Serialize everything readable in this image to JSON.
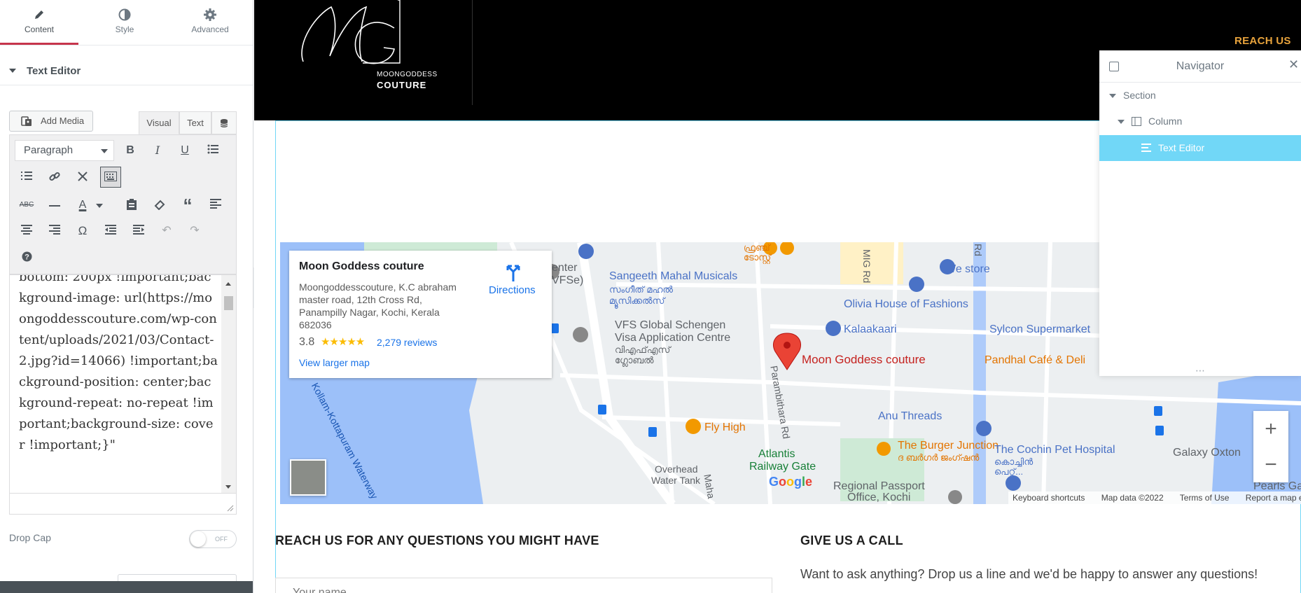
{
  "panel": {
    "tabs": [
      {
        "label": "Content",
        "icon": "pencil-icon"
      },
      {
        "label": "Style",
        "icon": "half-circle-icon"
      },
      {
        "label": "Advanced",
        "icon": "gear-icon"
      }
    ],
    "section_title": "Text Editor",
    "add_media": "Add Media",
    "editor_tabs": {
      "visual": "Visual",
      "text": "Text"
    },
    "format_select": "Paragraph",
    "editor_content": "bottom: 200px !important;background-image: url(https://moongoddesscouture.com/wp-content/uploads/2021/03/Contact-2.jpg?id=14066) !important;background-position: center;background-repeat: no-repeat !important;background-size: cover !important;}\"",
    "drop_cap_label": "Drop Cap",
    "toggle_state": "OFF"
  },
  "header": {
    "brand_line1": "MOONGODDESS",
    "brand_line2": "COUTURE",
    "nav_reach": "REACH US"
  },
  "map": {
    "place_name": "Moon Goddess couture",
    "address": "Moongoddesscouture, K.C abraham master road, 12th Cross Rd, Panampilly Nagar, Kochi, Kerala 682036",
    "rating": "3.8",
    "stars": "★★★★★",
    "reviews": "2,279 reviews",
    "larger_map": "View larger map",
    "directions": "Directions",
    "google_logo": "Google",
    "attribution": {
      "shortcuts": "Keyboard shortcuts",
      "data": "Map data ©2022",
      "terms": "Terms of Use",
      "report": "Report a map error"
    },
    "zoom_in": "+",
    "zoom_out": "−",
    "labels": {
      "center": "enter",
      "vfse": "VFSe)",
      "sangeeth": "Sangeeth Mahal Musicals",
      "sangeeth_ml": "സംഗീത് മഹൽ",
      "sangeeth_ml2": "മ്യൂസിക്കൽസ്",
      "we_store": "We store",
      "mig_rd": "MIG Rd",
      "olivia": "Olivia House of Fashions",
      "vfs1": "VFS Global Schengen",
      "vfs2": "Visa Application Centre",
      "vfs_ml1": "വിഎഫ്എസ്",
      "vfs_ml2": "ഗ്ലോബൽ",
      "kalaakaari": "Kalaakaari",
      "sylcon": "Sylcon Supermarket",
      "pin_label": "Moon Goddess couture",
      "pandhal": "Pandhal Café & Deli",
      "kollam": "Kollam-Kottapuram Waterway",
      "paramb": "Parambithara Rd",
      "fly_high": "Fly High",
      "anu": "Anu Threads",
      "burger": "The Burger Junction",
      "burger_ml": "ദ ബർഗർ ജംഗ്ഷൻ",
      "atlantis1": "Atlantis",
      "atlantis2": "Railway Gate",
      "overhead1": "Overhead",
      "overhead2": "Water Tank",
      "maha": "Maha",
      "cochin_pet": "The Cochin Pet Hospital",
      "cochin_ml1": "കൊച്ചിൻ",
      "cochin_ml2": "പെറ്റ്...",
      "galaxy": "Galaxy Oxton",
      "passport1": "Regional Passport",
      "passport2": "Office, Kochi",
      "pearls": "Pearls Garde",
      "ml_top1": "ഫ്രഞ്ച്",
      "ml_top2": "ടോസ്റ്റ്",
      "rd": "Rd"
    }
  },
  "page": {
    "reach_heading": "REACH US FOR ANY QUESTIONS YOU MIGHT HAVE",
    "call_heading": "GIVE US A CALL",
    "call_text": "Want to ask anything? Drop us a line and we'd be happy to answer any questions!",
    "name_placeholder": "Your name"
  },
  "navigator": {
    "title": "Navigator",
    "close": "✕",
    "rows": [
      {
        "label": "Section"
      },
      {
        "label": "Column"
      },
      {
        "label": "Text Editor"
      }
    ],
    "grip": "⋯"
  },
  "colors": {
    "accent": "#c6354c",
    "selection": "#71d7f7",
    "map_water": "#9cc0f9",
    "header_bg": "#000000"
  }
}
